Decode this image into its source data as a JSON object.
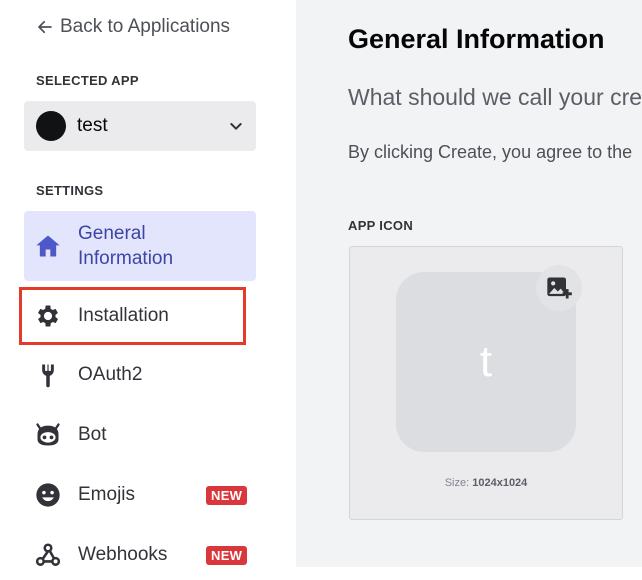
{
  "sidebar": {
    "back_label": "Back to Applications",
    "selected_app_label": "SELECTED APP",
    "app_name": "test",
    "settings_label": "SETTINGS",
    "items": [
      {
        "label": "General Information",
        "icon": "home-icon",
        "active": true
      },
      {
        "label": "Installation",
        "icon": "gear-icon"
      },
      {
        "label": "OAuth2",
        "icon": "wrench-icon"
      },
      {
        "label": "Bot",
        "icon": "bot-icon"
      },
      {
        "label": "Emojis",
        "icon": "emoji-icon",
        "badge": "NEW"
      },
      {
        "label": "Webhooks",
        "icon": "webhook-icon",
        "badge": "NEW"
      }
    ]
  },
  "main": {
    "title": "General Information",
    "subtitle": "What should we call your cre",
    "terms": "By clicking Create, you agree to the",
    "app_icon_label": "APP ICON",
    "icon_letter": "t",
    "size_label": "Size:",
    "size_value": "1024x1024"
  },
  "colors": {
    "active_bg": "#e3e5fc",
    "active_text": "#3c45a5",
    "badge_bg": "#da373c",
    "highlight": "#e43a2a"
  }
}
